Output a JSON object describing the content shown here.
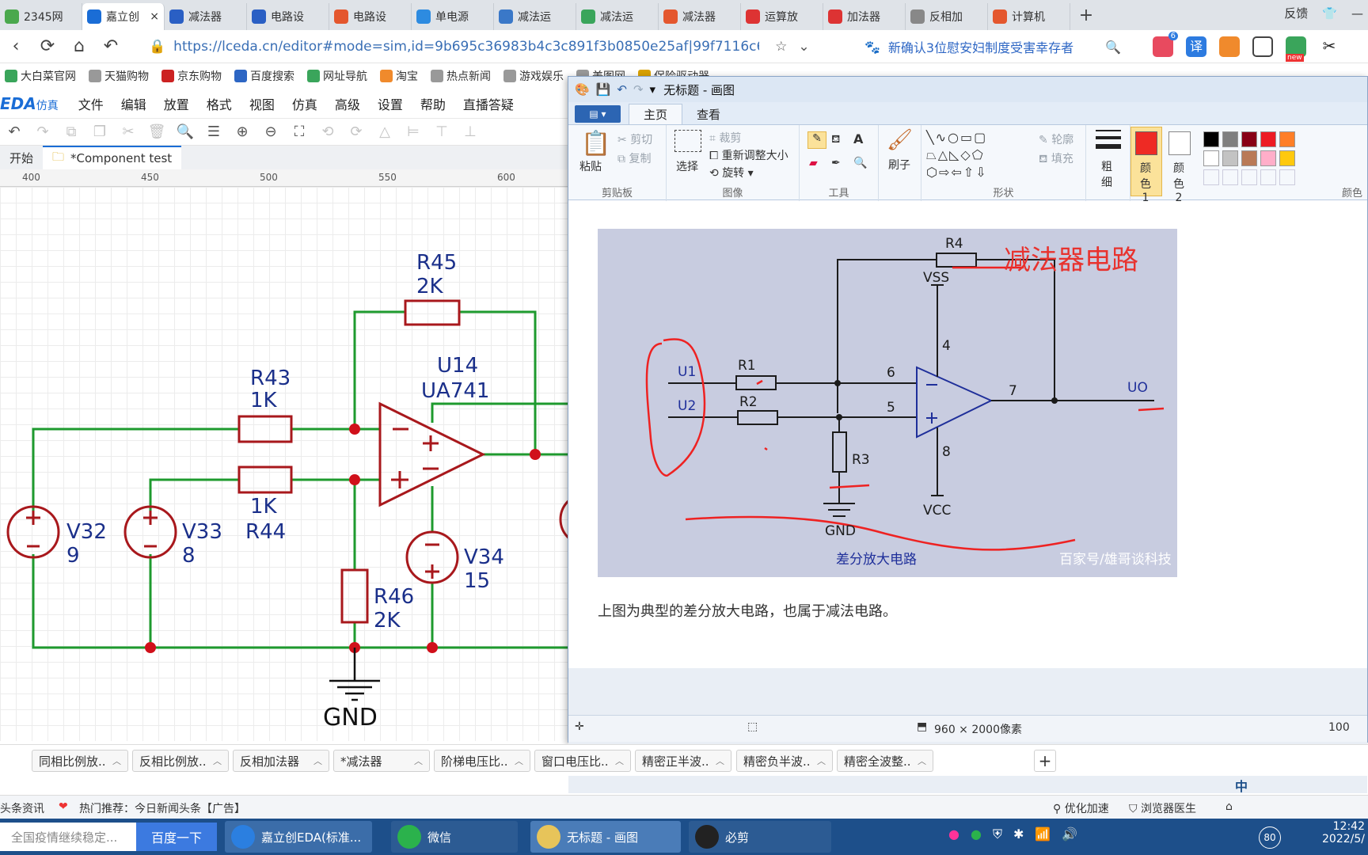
{
  "browser": {
    "tabs": [
      {
        "label": "2345网",
        "color": "#4aa84d"
      },
      {
        "label": "嘉立创",
        "color": "#1a6dd6",
        "active": true
      },
      {
        "label": "减法器",
        "color": "#2a5fc4"
      },
      {
        "label": "电路设",
        "color": "#2a5fc4"
      },
      {
        "label": "电路设",
        "color": "#e4572e"
      },
      {
        "label": "单电源",
        "color": "#2d8be0"
      },
      {
        "label": "减法运",
        "color": "#3a78c8"
      },
      {
        "label": "减法运",
        "color": "#3aa55b"
      },
      {
        "label": "减法器",
        "color": "#e4572e"
      },
      {
        "label": "运算放",
        "color": "#d33"
      },
      {
        "label": "加法器",
        "color": "#d33"
      },
      {
        "label": "反相加",
        "color": "#888"
      },
      {
        "label": "计算机",
        "color": "#e4572e"
      }
    ],
    "tab_close": "×",
    "new_tab": "+",
    "right_links": {
      "feedback": "反馈",
      "shirt": "👕",
      "min": "—",
      "max": "❐",
      "close": "✕"
    },
    "url": "https://lceda.cn/editor#mode=sim,id=9b695c36983b4c3c891f3b0850e25af|99f7116c6bbe4ac",
    "news_text": "新确认3位慰安妇制度受害幸存者",
    "ext_badge": "6",
    "ext_translate": "译",
    "ext_new": "new",
    "bookmarks": [
      "大白菜官网",
      "天猫购物",
      "京东购物",
      "百度搜索",
      "网址导航",
      "淘宝",
      "热点新闻",
      "游戏娱乐",
      "美图网",
      "保险驱动器"
    ]
  },
  "eda": {
    "logo": "EDA",
    "logo_sub": "仿真",
    "menu": [
      "文件",
      "编辑",
      "放置",
      "格式",
      "视图",
      "仿真",
      "高级",
      "设置",
      "帮助",
      "直播答疑"
    ],
    "tabs": [
      "开始",
      "*Component test"
    ],
    "ruler": [
      "400",
      "450",
      "500",
      "550",
      "600"
    ],
    "schematic": {
      "parts": [
        {
          "ref": "R45",
          "value": "2K"
        },
        {
          "ref": "R43",
          "value": "1K"
        },
        {
          "ref": "R44",
          "value": "1K"
        },
        {
          "ref": "R46",
          "value": "2K"
        },
        {
          "ref": "U14",
          "value": "UA741"
        },
        {
          "ref": "V32",
          "value": "9"
        },
        {
          "ref": "V33",
          "value": "8"
        },
        {
          "ref": "V34",
          "value": "15"
        }
      ],
      "gnd_label": "GND"
    },
    "sheet_tabs": [
      "同相比例放...",
      "反相比例放...",
      "反相加法器",
      "*减法器",
      "阶梯电压比...",
      "窗口电压比...",
      "精密正半波...",
      "精密负半波...",
      "精密全波整...",
      "+"
    ]
  },
  "paint": {
    "title": "无标题 - 画图",
    "ribbon_tabs": [
      "主页",
      "查看"
    ],
    "file_menu": "▤ ▾",
    "groups": {
      "clipboard": {
        "label": "剪贴板",
        "paste": "粘贴",
        "cut": "剪切",
        "copy": "复制"
      },
      "image": {
        "label": "图像",
        "select": "选择",
        "crop": "裁剪",
        "resize": "重新调整大小",
        "rotate": "旋转"
      },
      "tools": {
        "label": "工具"
      },
      "brush": {
        "label": "刷子"
      },
      "shapes": {
        "label": "形状",
        "outline": "轮廓",
        "fill": "填充"
      },
      "size": {
        "label": "粗细"
      },
      "color1": {
        "label": "颜色 1",
        "value": "#ee2a24"
      },
      "color2": {
        "label": "颜色 2",
        "value": "#ffffff"
      },
      "colors": {
        "label": "颜色"
      }
    },
    "palette_row1": [
      "#000000",
      "#7f7f7f",
      "#880015",
      "#ed1c24",
      "#ff7f27"
    ],
    "palette_row2": [
      "#ffffff",
      "#c3c3c3",
      "#b97a57",
      "#ffaec9",
      "#ffc90e"
    ],
    "diagram": {
      "title": "减法器电路",
      "caption": "差分放大电路",
      "watermark": "百家号/雄哥谈科技",
      "labels": {
        "r4": "R4",
        "r1": "R1",
        "r2": "R2",
        "r3": "R3",
        "vss": "VSS",
        "vcc": "VCC",
        "gnd": "GND",
        "u1": "U1",
        "u2": "U2",
        "uo": "UO",
        "pin6": "6",
        "pin5": "5",
        "pin7": "7",
        "pin4": "4",
        "pin8": "8"
      }
    },
    "body_text": "上图为典型的差分放大电路，也属于减法电路。",
    "status": {
      "size": "960 × 2000像素",
      "zoom": "100"
    }
  },
  "statusbar": {
    "news": "头条资讯",
    "hot": "热门推荐：今日新闻头条【广告】",
    "speed": "优化加速",
    "doctor": "浏览器医生"
  },
  "taskbar": {
    "search_placeholder": "全国疫情继续稳定...",
    "search_button": "百度一下",
    "apps": [
      "嘉立创EDA(标准...",
      "微信",
      "无标题 - 画图",
      "必剪"
    ],
    "ime": "中",
    "volume": "80",
    "time": "12:42",
    "date": "2022/5/"
  }
}
